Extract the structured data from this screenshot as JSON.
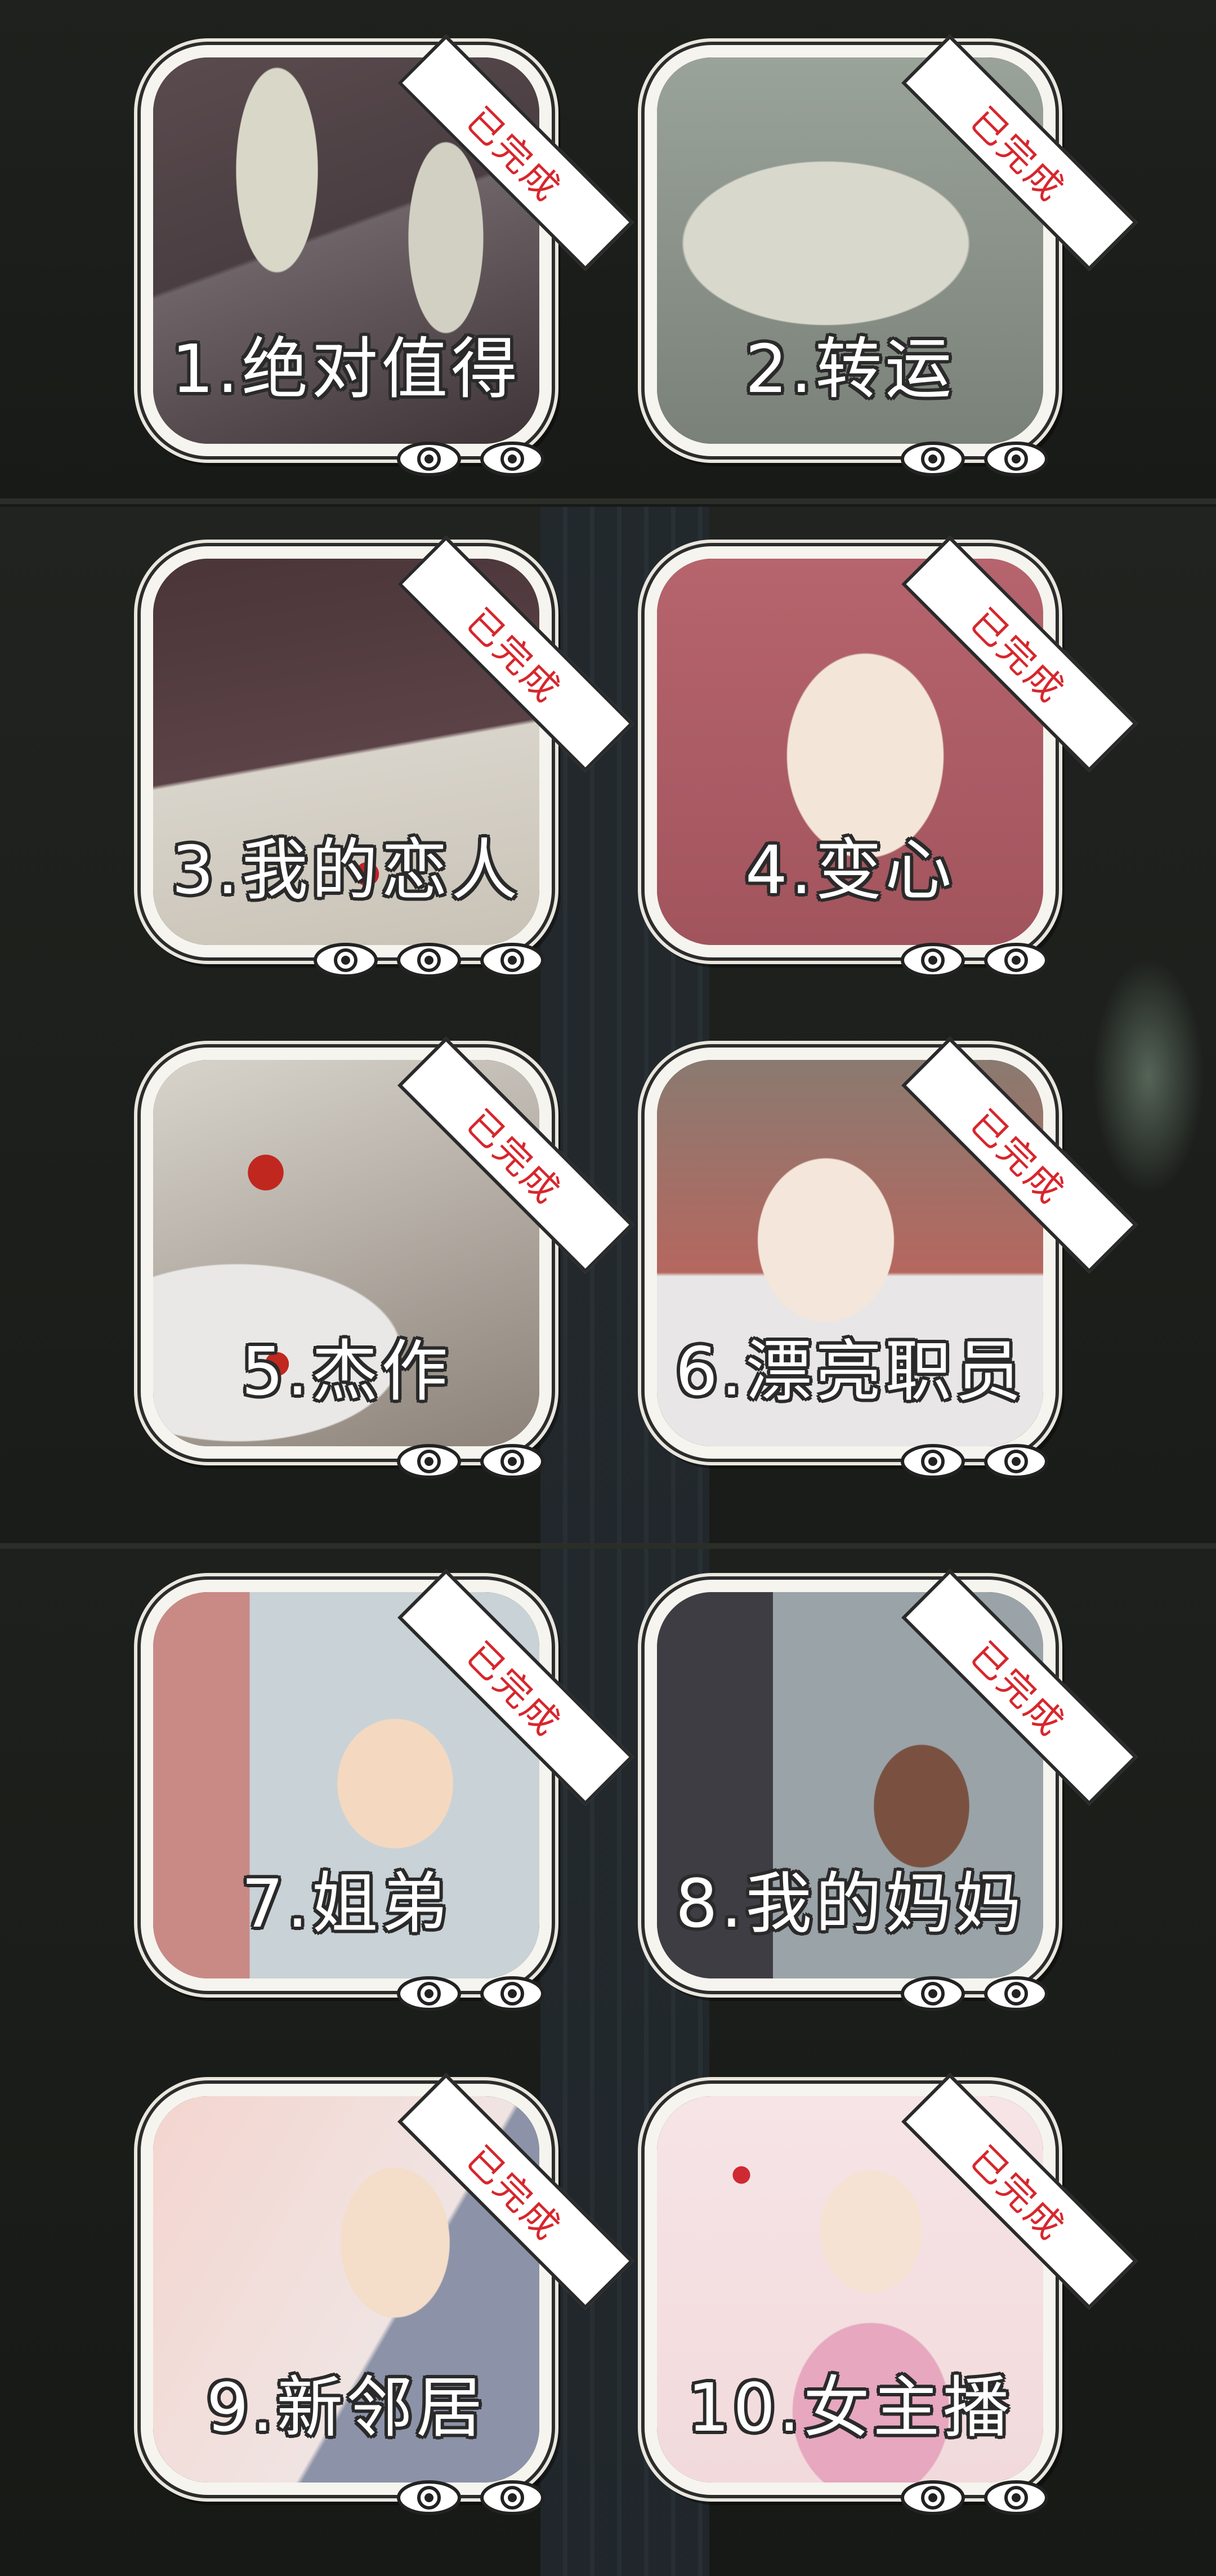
{
  "status_ribbon": "已完成",
  "chapters": [
    {
      "title": "1.绝对值得",
      "eyes": 2
    },
    {
      "title": "2.转运",
      "eyes": 2
    },
    {
      "title": "3.我的恋人",
      "eyes": 3
    },
    {
      "title": "4.变心",
      "eyes": 2
    },
    {
      "title": "5.杰作",
      "eyes": 2
    },
    {
      "title": "6.漂亮职员",
      "eyes": 2
    },
    {
      "title": "7.姐弟",
      "eyes": 2
    },
    {
      "title": "8.我的妈妈",
      "eyes": 2
    },
    {
      "title": "9.新邻居",
      "eyes": 2
    },
    {
      "title": "10.女主播",
      "eyes": 2
    }
  ],
  "colors": {
    "background": "#1b1d1a",
    "frame": "#f6f4ee",
    "ribbon_text": "#d7262c",
    "outline": "#2a2a2a"
  },
  "icons": {
    "ribbon": "completed-ribbon",
    "rating": "eye-icon"
  }
}
